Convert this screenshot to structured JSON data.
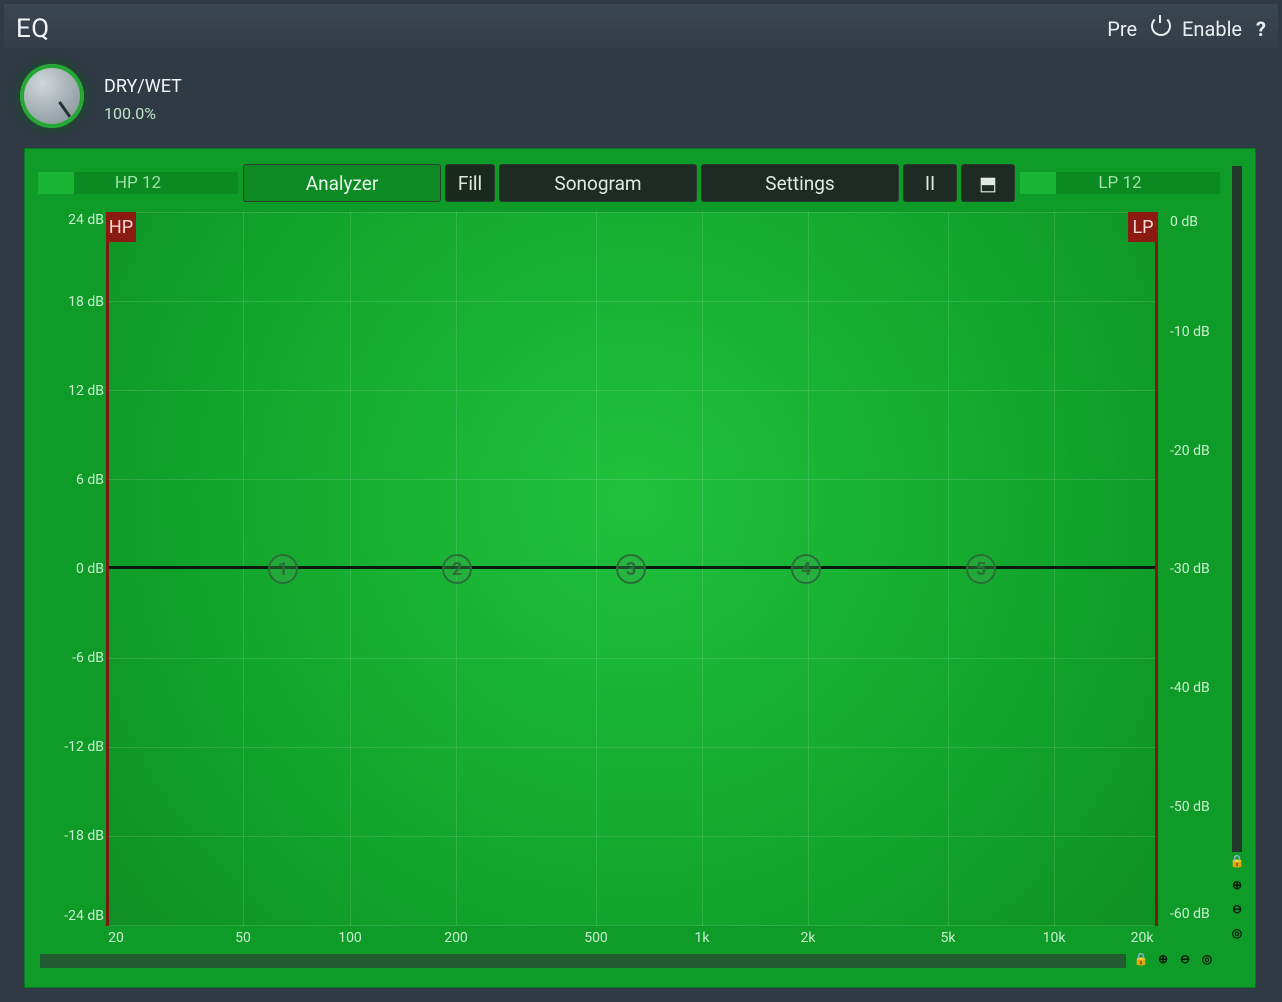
{
  "header": {
    "title": "EQ",
    "pre_label": "Pre",
    "enable_label": "Enable",
    "help_label": "?"
  },
  "drywet": {
    "label": "DRY/WET",
    "value": "100.0%"
  },
  "toolbar": {
    "hp": "HP 12",
    "analyzer": "Analyzer",
    "fill": "Fill",
    "sonogram": "Sonogram",
    "settings": "Settings",
    "pause_symbol": "II",
    "pin_symbol": "⬒",
    "lp": "LP 12"
  },
  "graph": {
    "hp_tag": "HP",
    "lp_tag": "LP",
    "left_axis": [
      "24 dB",
      "18 dB",
      "12 dB",
      "6 dB",
      "0 dB",
      "-6 dB",
      "-12 dB",
      "-18 dB",
      "-24 dB"
    ],
    "right_axis": [
      "0 dB",
      "-10 dB",
      "-20 dB",
      "-30 dB",
      "-40 dB",
      "-50 dB",
      "-60 dB"
    ],
    "x_axis": [
      "20",
      "50",
      "100",
      "200",
      "500",
      "1k",
      "2k",
      "5k",
      "10k",
      "20k"
    ],
    "bands": [
      "1",
      "2",
      "3",
      "4",
      "5"
    ]
  },
  "icons": {
    "lock": "🔒",
    "zoom_in": "⊕",
    "zoom_out": "⊖",
    "zoom_reset": "◎"
  },
  "colors": {
    "panel": "#0f9b28",
    "graph_center": "#20c13d",
    "hp_lp": "#8b1b12",
    "ui_dark": "#1d2b22"
  }
}
